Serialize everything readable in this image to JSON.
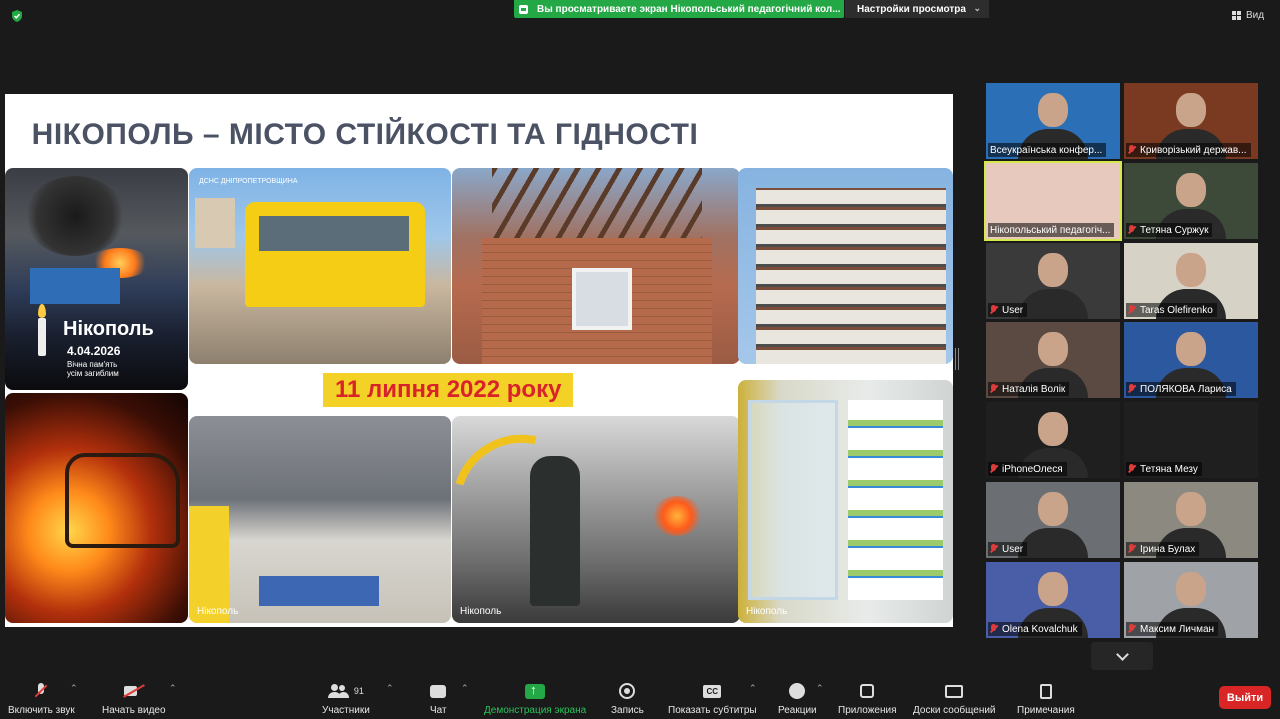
{
  "topbar": {
    "share_banner": "Вы просматриваете экран Нікопольський педагогічний кол...",
    "view_settings": "Настройки просмотра",
    "view_button": "Вид"
  },
  "slide": {
    "title": "НІКОПОЛЬ – МІСТО СТІЙКОСТІ ТА ГІДНОСТІ",
    "date_banner": "11 липня 2022 року",
    "photo1_city": "Нікополь",
    "photo1_date": "4.04.2026",
    "photo1_memory_1": "Вічна пам'ять",
    "photo1_memory_2": "усім загиблим",
    "photo2_logo": "ДСНС ДНІПРОПЕТРОВЩИНА",
    "photo6_caption": "Нікополь",
    "photo7_caption": "Нікополь",
    "photo8_caption": "Нікополь"
  },
  "participants": [
    {
      "name": "Всеукраїнська конфер...",
      "muted": false
    },
    {
      "name": "Криворізький держав...",
      "muted": true
    },
    {
      "name": "Нікопольський педагогіч...",
      "muted": false,
      "active": true
    },
    {
      "name": "Тетяна Суржук",
      "muted": true
    },
    {
      "name": "User",
      "muted": true
    },
    {
      "name": "Taras Olefirenko",
      "muted": true
    },
    {
      "name": "Наталія Волік",
      "muted": true
    },
    {
      "name": "ПОЛЯКОВА Лариса",
      "muted": true
    },
    {
      "name": "iPhoneОлеся",
      "muted": true
    },
    {
      "name": "Тетяна Мезу",
      "muted": true
    },
    {
      "name": "User",
      "muted": true
    },
    {
      "name": "Ірина Булах",
      "muted": true
    },
    {
      "name": "Olena Kovalchuk",
      "muted": true
    },
    {
      "name": "Максим Личман",
      "muted": true
    }
  ],
  "toolbar": {
    "audio": "Включить звук",
    "video": "Начать видео",
    "participants": "Участники",
    "participants_count": "91",
    "chat": "Чат",
    "share": "Демонстрация экрана",
    "record": "Запись",
    "captions": "Показать субтитры",
    "captions_icon": "CC",
    "reactions": "Реакции",
    "apps": "Приложения",
    "boards": "Доски сообщений",
    "notes": "Примечания",
    "leave": "Выйти"
  },
  "colors": {
    "accent_green": "#23a845",
    "leave_red": "#d92525",
    "active_speaker": "#d6e94a",
    "slide_title": "#4a5264",
    "date_bg": "#f4d126",
    "date_text": "#d8232a"
  }
}
